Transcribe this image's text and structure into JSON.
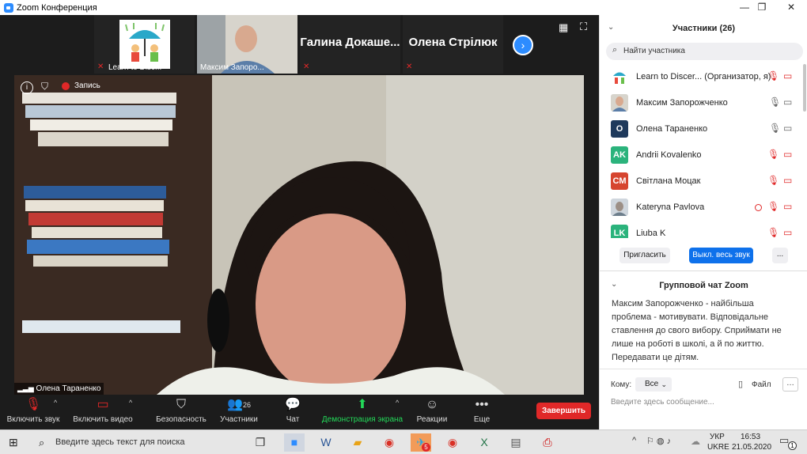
{
  "window": {
    "title": "Zoom Конференция"
  },
  "thumbnails": [
    {
      "name": "Learn to Disc..."
    },
    {
      "name": "Максим Запоро..."
    },
    {
      "name": "Галина  Докаше..."
    },
    {
      "name": "Олена Стрілюк"
    }
  ],
  "main_video": {
    "recording": "Запись",
    "speaker": "Олена Тараненко"
  },
  "toolbar": {
    "unmute": "Включить звук",
    "start_video": "Включить видео",
    "security": "Безопасность",
    "participants": "Участники",
    "participants_count": "26",
    "chat": "Чат",
    "share": "Демонстрация экрана",
    "reactions": "Реакции",
    "more": "Еще",
    "end": "Завершить"
  },
  "panel": {
    "title": "Участники (26)",
    "search_placeholder": "Найти участника",
    "participants": [
      {
        "name": "Learn to Discer...",
        "role": "(Организатор, я)",
        "initials": ""
      },
      {
        "name": "Максим Запорожченко",
        "initials": ""
      },
      {
        "name": "Олена Тараненко",
        "initials": "О"
      },
      {
        "name": "Andrii Kovalenko",
        "initials": "AK"
      },
      {
        "name": "Світлана Моцак",
        "initials": "CM"
      },
      {
        "name": "Kateryna Pavlova",
        "initials": ""
      },
      {
        "name": "Liuba K",
        "initials": "LK"
      }
    ],
    "invite": "Пригласить",
    "mute_all": "Выкл. весь звук",
    "more": "...",
    "chat_title": "Групповой чат Zoom",
    "chat_message": "Максим Запорожченко - найбільша проблема - мотивувати. Відповідальне ставлення до свого вибору. Сприймати не лише на роботі в школі, а й по життю. Передавати це дітям.",
    "to_label": "Кому:",
    "to_value": "Все",
    "file": "Файл",
    "message_placeholder": "Введите здесь сообщение..."
  },
  "taskbar": {
    "search_placeholder": "Введите здесь текст для поиска",
    "lang_top": "УКР",
    "lang_bottom": "UKRE",
    "time": "16:53",
    "date": "21.05.2020",
    "notif_count": "1",
    "telegram_badge": "5"
  },
  "colors": {
    "accent": "#0e71eb",
    "end": "#e02828",
    "share": "#23d959"
  }
}
